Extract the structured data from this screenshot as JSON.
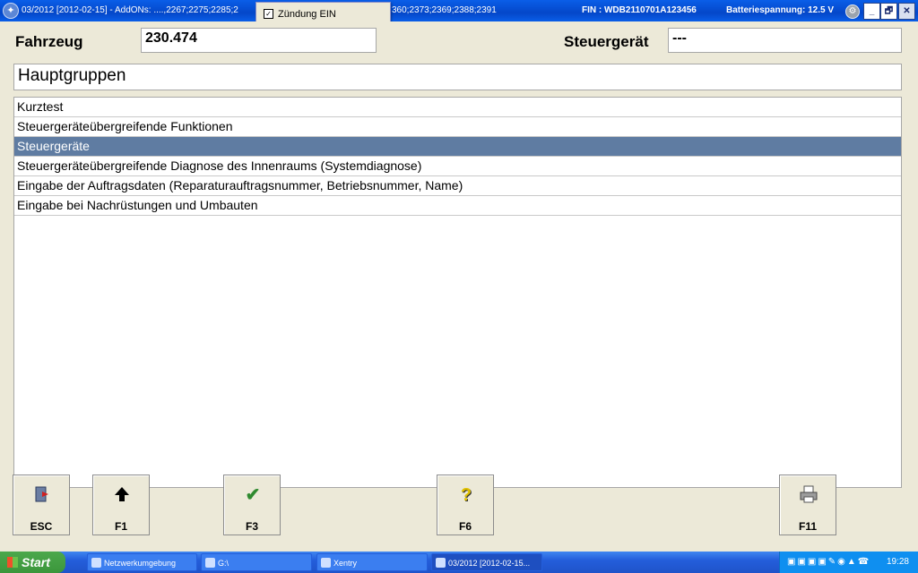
{
  "titlebar": {
    "left_text": "03/2012 [2012-02-15] - AddONs: ....,2267;2275;2285;2",
    "mid_text": "360;2373;2369;2388;2391",
    "fin": "FIN : WDB2110701A123456",
    "battery": "Batteriespannung: 12.5 V",
    "minimize": "_",
    "restore": "🗗",
    "close": "✕"
  },
  "popup": {
    "checkbox": "✓",
    "label": "Zündung EIN"
  },
  "header": {
    "vehicle_label": "Fahrzeug",
    "vehicle_value": "230.474",
    "ecu_label": "Steuergerät",
    "ecu_value": "---"
  },
  "section_title": "Hauptgruppen",
  "list": {
    "items": [
      "Kurztest",
      "Steuergeräteübergreifende Funktionen",
      "Steuergeräte",
      "Steuergeräteübergreifende Diagnose des Innenraums (Systemdiagnose)",
      "Eingabe der Auftragsdaten (Reparaturauftragsnummer, Betriebsnummer, Name)",
      "Eingabe bei Nachrüstungen und Umbauten"
    ],
    "selected_index": 2
  },
  "function_keys": {
    "esc": "ESC",
    "f1": "F1",
    "f3": "F3",
    "f6": "F6",
    "f11": "F11"
  },
  "icons": {
    "esc": "exit-door-icon",
    "f1": "arrow-up-icon",
    "f3": "checkmark-icon",
    "f6": "help-icon",
    "f11": "printer-icon"
  },
  "taskbar": {
    "start": "Start",
    "tasks": [
      "Netzwerkumgebung",
      "G:\\",
      "Xentry",
      "03/2012 [2012-02-15..."
    ],
    "clock": "19:28"
  },
  "colors": {
    "selection": "#5f7ca2",
    "titlebar": "#0a5ee8"
  }
}
